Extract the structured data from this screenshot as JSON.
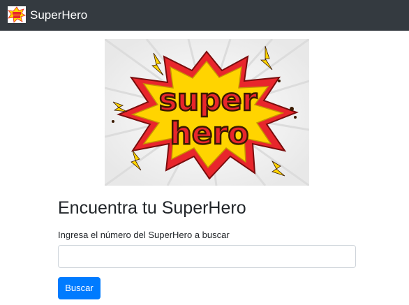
{
  "navbar": {
    "brand_name": "SuperHero",
    "logo_icon": "superhero-logo-icon",
    "background": "#343a40"
  },
  "hero": {
    "image_text_line1": "super",
    "image_text_line2": "hero",
    "colors": {
      "burst": "#ffd400",
      "letters": "#e8262c",
      "outline": "#3a1a00",
      "rays": "#f0f0f0"
    }
  },
  "main": {
    "title": "Encuentra tu SuperHero",
    "input_label": "Ingresa el número del SuperHero a buscar",
    "input_value": "",
    "input_placeholder": "",
    "search_button_label": "Buscar",
    "button_color": "#007bff"
  }
}
